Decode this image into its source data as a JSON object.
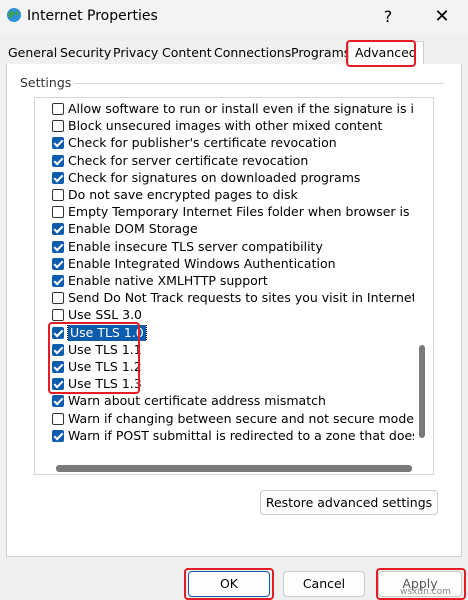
{
  "window": {
    "title": "Internet Properties",
    "help_label": "?",
    "close_label": "✕"
  },
  "tabs": [
    {
      "label": "General"
    },
    {
      "label": "Security"
    },
    {
      "label": "Privacy"
    },
    {
      "label": "Content"
    },
    {
      "label": "Connections"
    },
    {
      "label": "Programs"
    },
    {
      "label": "Advanced"
    }
  ],
  "active_tab": "Advanced",
  "settings": {
    "group_label": "Settings",
    "items": [
      {
        "label": "Allow software to run or install even if the signature is invalid",
        "checked": false
      },
      {
        "label": "Block unsecured images with other mixed content",
        "checked": false
      },
      {
        "label": "Check for publisher's certificate revocation",
        "checked": true
      },
      {
        "label": "Check for server certificate revocation",
        "checked": true
      },
      {
        "label": "Check for signatures on downloaded programs",
        "checked": true
      },
      {
        "label": "Do not save encrypted pages to disk",
        "checked": false
      },
      {
        "label": "Empty Temporary Internet Files folder when browser is closed",
        "checked": false
      },
      {
        "label": "Enable DOM Storage",
        "checked": true
      },
      {
        "label": "Enable insecure TLS server compatibility",
        "checked": true
      },
      {
        "label": "Enable Integrated Windows Authentication",
        "checked": true
      },
      {
        "label": "Enable native XMLHTTP support",
        "checked": true
      },
      {
        "label": "Send Do Not Track requests to sites you visit in Internet Explorer",
        "checked": false
      },
      {
        "label": "Use SSL 3.0",
        "checked": false
      },
      {
        "label": "Use TLS 1.0",
        "checked": true,
        "selected": true
      },
      {
        "label": "Use TLS 1.1",
        "checked": true
      },
      {
        "label": "Use TLS 1.2",
        "checked": true
      },
      {
        "label": "Use TLS 1.3",
        "checked": true
      },
      {
        "label": "Warn about certificate address mismatch",
        "checked": true
      },
      {
        "label": "Warn if changing between secure and not secure mode",
        "checked": false
      },
      {
        "label": "Warn if POST submittal is redirected to a zone that does not permit posts",
        "checked": true
      }
    ]
  },
  "buttons": {
    "restore": "Restore advanced settings",
    "ok": "OK",
    "cancel": "Cancel",
    "apply": "Apply"
  },
  "watermark": "wsxdn.com",
  "colors": {
    "accent": "#0b5cad",
    "highlight": "#e41c23"
  }
}
